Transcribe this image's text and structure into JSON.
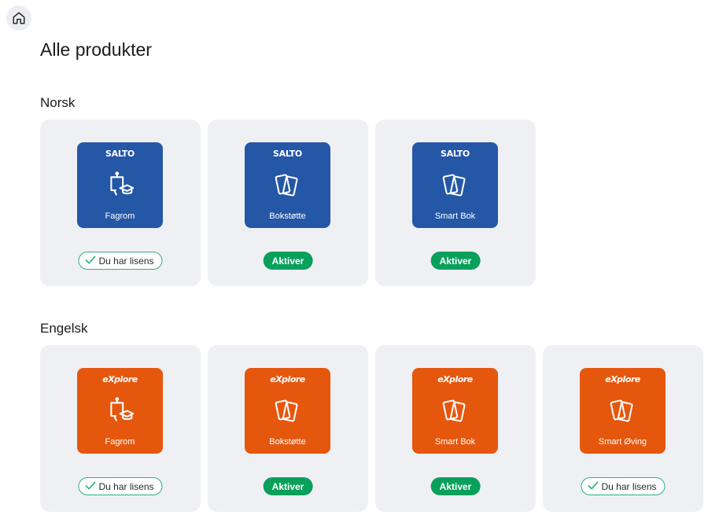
{
  "page": {
    "title": "Alle produkter",
    "home_icon": "home-icon"
  },
  "colors": {
    "saltro": "#2557a7",
    "explore": "#e6570e",
    "activate": "#0aa05c",
    "license_border": "#2bb37a",
    "card_bg": "#eff0f4"
  },
  "sections": [
    {
      "title": "Norsk",
      "products": [
        {
          "brand": "SALTO",
          "label": "Fagrom",
          "icon": "classroom-icon",
          "status": "Du har lisens",
          "status_type": "license"
        },
        {
          "brand": "SALTO",
          "label": "Bokstøtte",
          "icon": "cards-icon",
          "status": "Aktiver",
          "status_type": "activate"
        },
        {
          "brand": "SALTO",
          "label": "Smart Bok",
          "icon": "cards-icon",
          "status": "Aktiver",
          "status_type": "activate"
        }
      ]
    },
    {
      "title": "Engelsk",
      "products": [
        {
          "brand": "eXplore",
          "label": "Fagrom",
          "icon": "classroom-icon",
          "status": "Du har lisens",
          "status_type": "license"
        },
        {
          "brand": "eXplore",
          "label": "Bokstøtte",
          "icon": "cards-icon",
          "status": "Aktiver",
          "status_type": "activate"
        },
        {
          "brand": "eXplore",
          "label": "Smart Bok",
          "icon": "cards-icon",
          "status": "Aktiver",
          "status_type": "activate"
        },
        {
          "brand": "eXplore",
          "label": "Smart Øving",
          "icon": "cards-icon",
          "status": "Du har lisens",
          "status_type": "license"
        }
      ]
    }
  ]
}
